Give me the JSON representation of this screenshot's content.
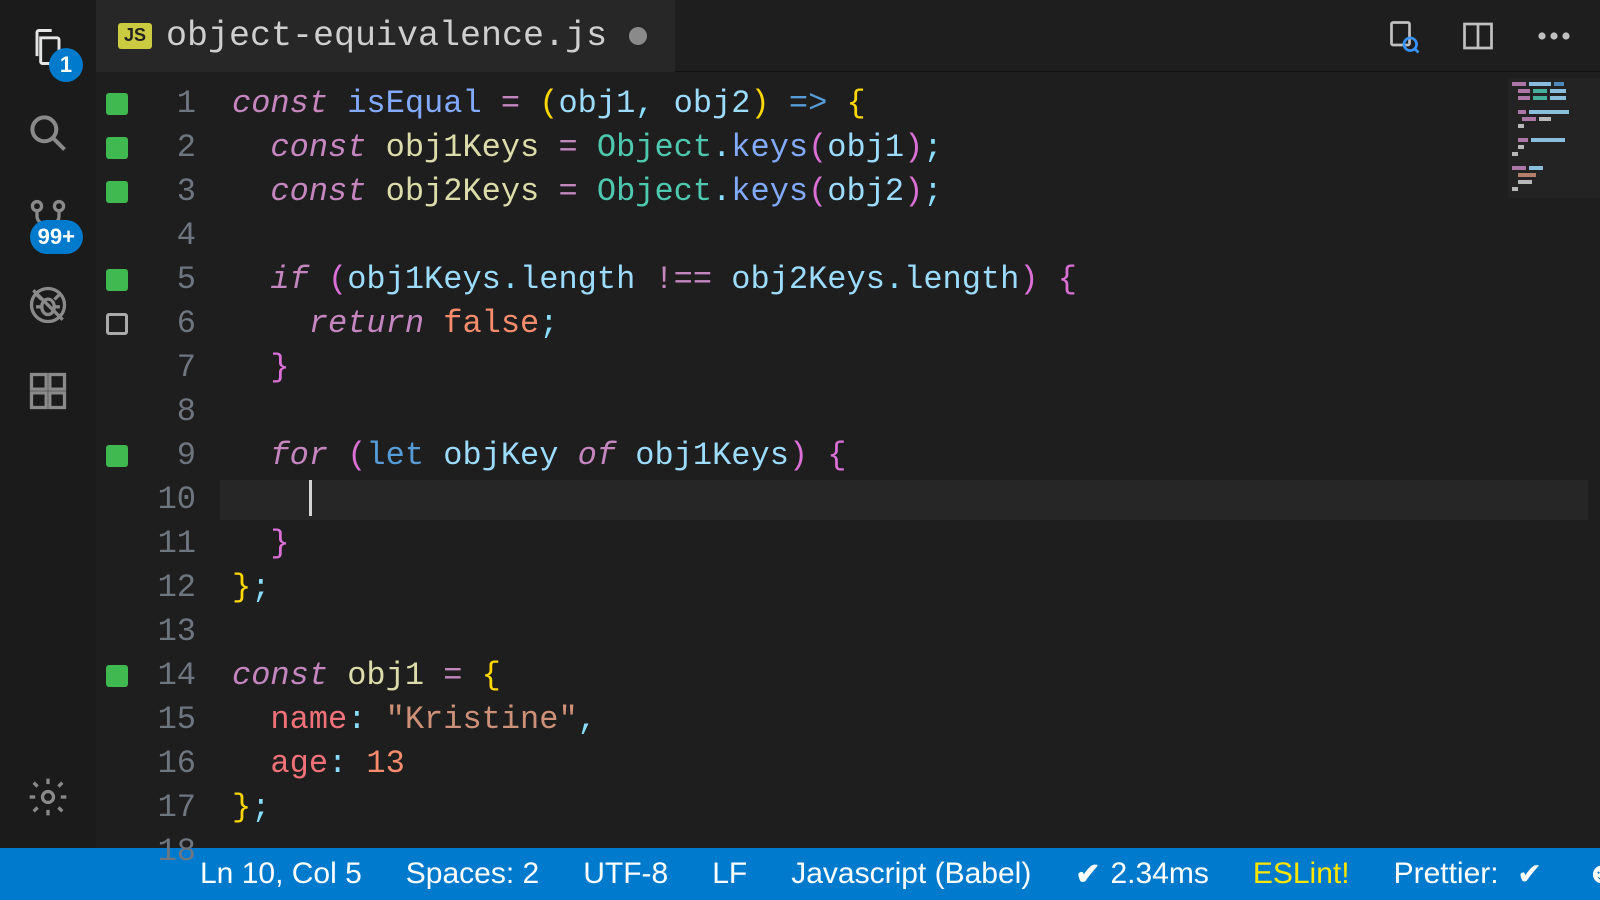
{
  "activity": {
    "explorer_badge": "1",
    "scm_badge": "99+"
  },
  "tab": {
    "lang_icon": "JS",
    "filename": "object-equivalence.js"
  },
  "statusbar": {
    "position": "Ln 10, Col 5",
    "indent": "Spaces: 2",
    "encoding": "UTF-8",
    "eol": "LF",
    "language": "Javascript (Babel)",
    "perf": "2.34ms",
    "eslint": "ESLint!",
    "prettier": "Prettier:"
  },
  "cursor": {
    "line": 10,
    "col": 5
  },
  "gutter_markers": {
    "1": "green",
    "2": "green",
    "3": "green",
    "5": "green",
    "6": "outline",
    "9": "green",
    "14": "green"
  },
  "code": [
    [
      [
        0,
        "kw",
        "const"
      ],
      [
        0,
        "plain",
        " "
      ],
      [
        0,
        "fn",
        "isEqual"
      ],
      [
        0,
        "plain",
        " "
      ],
      [
        0,
        "op",
        "="
      ],
      [
        0,
        "plain",
        " "
      ],
      [
        0,
        "paren",
        "("
      ],
      [
        0,
        "name",
        "obj1"
      ],
      [
        0,
        "pun",
        ","
      ],
      [
        0,
        "plain",
        " "
      ],
      [
        0,
        "name",
        "obj2"
      ],
      [
        0,
        "paren",
        ")"
      ],
      [
        0,
        "plain",
        " "
      ],
      [
        0,
        "def",
        "=>"
      ],
      [
        0,
        "plain",
        " "
      ],
      [
        0,
        "paren",
        "{"
      ]
    ],
    [
      [
        1,
        "kw",
        "const"
      ],
      [
        0,
        "plain",
        " "
      ],
      [
        0,
        "var",
        "obj1Keys"
      ],
      [
        0,
        "plain",
        " "
      ],
      [
        0,
        "op",
        "="
      ],
      [
        0,
        "plain",
        " "
      ],
      [
        0,
        "type",
        "Object"
      ],
      [
        0,
        "pun",
        "."
      ],
      [
        0,
        "call",
        "keys"
      ],
      [
        0,
        "par2",
        "("
      ],
      [
        0,
        "name",
        "obj1"
      ],
      [
        0,
        "par2",
        ")"
      ],
      [
        0,
        "pun",
        ";"
      ]
    ],
    [
      [
        1,
        "kw",
        "const"
      ],
      [
        0,
        "plain",
        " "
      ],
      [
        0,
        "var",
        "obj2Keys"
      ],
      [
        0,
        "plain",
        " "
      ],
      [
        0,
        "op",
        "="
      ],
      [
        0,
        "plain",
        " "
      ],
      [
        0,
        "type",
        "Object"
      ],
      [
        0,
        "pun",
        "."
      ],
      [
        0,
        "call",
        "keys"
      ],
      [
        0,
        "par2",
        "("
      ],
      [
        0,
        "name",
        "obj2"
      ],
      [
        0,
        "par2",
        ")"
      ],
      [
        0,
        "pun",
        ";"
      ]
    ],
    [],
    [
      [
        1,
        "kw",
        "if"
      ],
      [
        0,
        "plain",
        " "
      ],
      [
        0,
        "par2",
        "("
      ],
      [
        0,
        "name",
        "obj1Keys"
      ],
      [
        0,
        "pun",
        "."
      ],
      [
        0,
        "name",
        "length"
      ],
      [
        0,
        "plain",
        " "
      ],
      [
        0,
        "op",
        "!=="
      ],
      [
        0,
        "plain",
        " "
      ],
      [
        0,
        "name",
        "obj2Keys"
      ],
      [
        0,
        "pun",
        "."
      ],
      [
        0,
        "name",
        "length"
      ],
      [
        0,
        "par2",
        ")"
      ],
      [
        0,
        "plain",
        " "
      ],
      [
        0,
        "par2",
        "{"
      ]
    ],
    [
      [
        2,
        "kw",
        "return"
      ],
      [
        0,
        "plain",
        " "
      ],
      [
        0,
        "bool",
        "false"
      ],
      [
        0,
        "pun",
        ";"
      ]
    ],
    [
      [
        1,
        "par2",
        "}"
      ]
    ],
    [],
    [
      [
        1,
        "kw",
        "for"
      ],
      [
        0,
        "plain",
        " "
      ],
      [
        0,
        "par2",
        "("
      ],
      [
        0,
        "def",
        "let"
      ],
      [
        0,
        "plain",
        " "
      ],
      [
        0,
        "name",
        "objKey"
      ],
      [
        0,
        "plain",
        " "
      ],
      [
        0,
        "kw",
        "of"
      ],
      [
        0,
        "plain",
        " "
      ],
      [
        0,
        "name",
        "obj1Keys"
      ],
      [
        0,
        "par2",
        ")"
      ],
      [
        0,
        "plain",
        " "
      ],
      [
        0,
        "par2",
        "{"
      ]
    ],
    [
      [
        2,
        "cursor",
        ""
      ]
    ],
    [
      [
        1,
        "par2",
        "}"
      ]
    ],
    [
      [
        0,
        "paren",
        "}"
      ],
      [
        0,
        "pun",
        ";"
      ]
    ],
    [],
    [
      [
        0,
        "kw",
        "const"
      ],
      [
        0,
        "plain",
        " "
      ],
      [
        0,
        "var",
        "obj1"
      ],
      [
        0,
        "plain",
        " "
      ],
      [
        0,
        "op",
        "="
      ],
      [
        0,
        "plain",
        " "
      ],
      [
        0,
        "paren",
        "{"
      ]
    ],
    [
      [
        1,
        "prop",
        "name"
      ],
      [
        0,
        "pun",
        ":"
      ],
      [
        0,
        "plain",
        " "
      ],
      [
        0,
        "str",
        "\"Kristine\""
      ],
      [
        0,
        "pun",
        ","
      ]
    ],
    [
      [
        1,
        "prop",
        "age"
      ],
      [
        0,
        "pun",
        ":"
      ],
      [
        0,
        "plain",
        " "
      ],
      [
        0,
        "num",
        "13"
      ]
    ],
    [
      [
        0,
        "paren",
        "}"
      ],
      [
        0,
        "pun",
        ";"
      ]
    ],
    []
  ]
}
